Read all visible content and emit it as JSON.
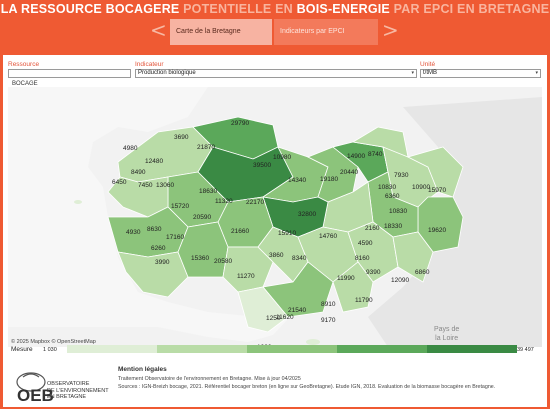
{
  "title": {
    "part1": "LA RESSOURCE BOCAGERE ",
    "part2": "POTENTIELLE EN ",
    "part3": "BOIS-ENERGIE",
    "part4": " PAR EPCI EN BRETAGNE"
  },
  "nav": {
    "tab1_label": "Carte de la Bretagne",
    "tab2_label": "Indicateurs par EPCI",
    "left_arrow": "<",
    "right_arrow": ">"
  },
  "filters": {
    "ressource": {
      "label": "Ressource",
      "value": "",
      "selected_item": "BOCAGE"
    },
    "indicateur": {
      "label": "Indicateur",
      "value": "Production biologique",
      "arrow": "▾"
    },
    "unite": {
      "label": "Unité",
      "value": "t/tMB",
      "arrow": "▾"
    }
  },
  "map": {
    "credit": "© 2025 Mapbox © OpenStreetMap",
    "region_label_line1": "Pays de",
    "region_label_line2": "la Loire",
    "values": [
      "29790",
      "3690",
      "4980",
      "21870",
      "12480",
      "8490",
      "6450",
      "7450",
      "13060",
      "18630",
      "15720",
      "39500",
      "10980",
      "14340",
      "11320",
      "22170",
      "20590",
      "8630",
      "17160",
      "4930",
      "6260",
      "21660",
      "15360",
      "20580",
      "3990",
      "11270",
      "3860",
      "8340",
      "15910",
      "32800",
      "14760",
      "20440",
      "19180",
      "8740",
      "14900",
      "7930",
      "6360",
      "10830",
      "10900",
      "15970",
      "18330",
      "19620",
      "10830",
      "2160",
      "4590",
      "8160",
      "9390",
      "12090",
      "6860",
      "11990",
      "8910",
      "11790",
      "21540",
      "1250",
      "9170",
      "1030",
      "11620"
    ]
  },
  "legend": {
    "label": "Mesure",
    "min": "1 030",
    "max": "39 497",
    "colors": [
      "#dfeed6",
      "#b9dca7",
      "#8cc47b",
      "#5ba85a",
      "#3a8a44"
    ]
  },
  "footer": {
    "logo_text": "OEB",
    "logo_sub": [
      "OBSERVATOIRE",
      "DE L'ENVIRONNEMENT",
      "EN BRETAGNE"
    ],
    "mention_title": "Mention légales",
    "line1": "Traitement Observatoire de l'environnement en Bretagne. Mise à jour 04/2025",
    "line2": "Sources : IGN-Breizh bocage, 2021. Référentiel bocager breton (en ligne sur GeoBretagne). Etude IGN, 2018. Evaluation de la biomasse bocagère en Bretagne."
  }
}
